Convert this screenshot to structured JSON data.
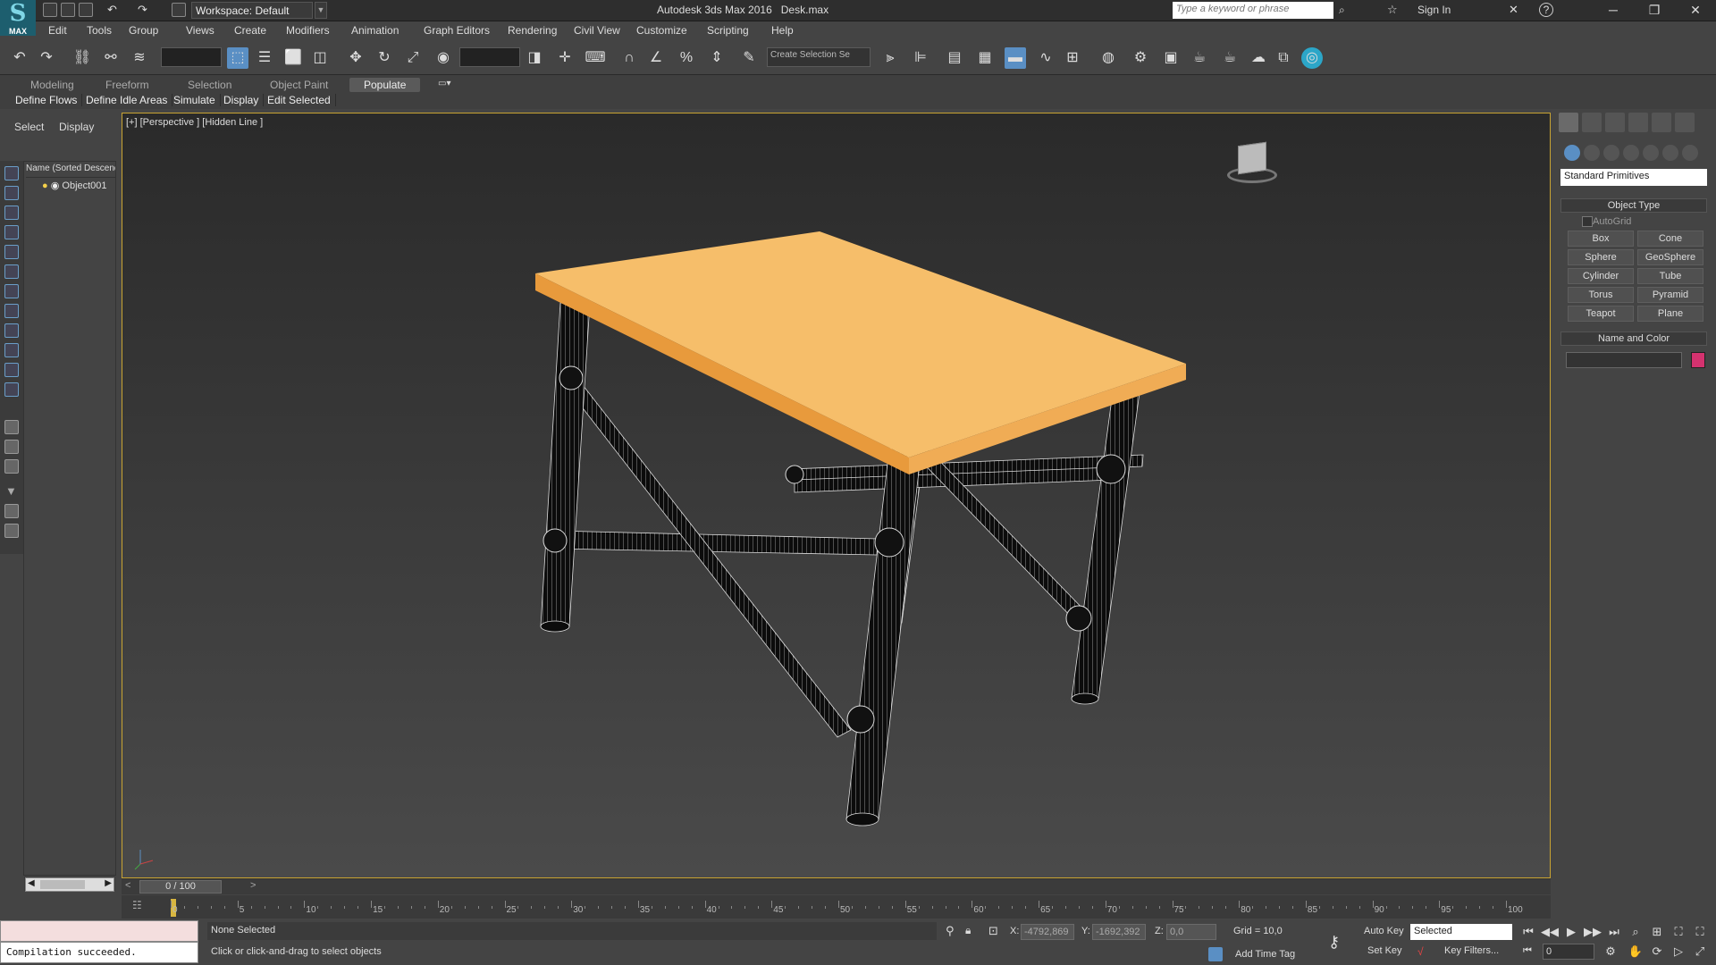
{
  "titlebar": {
    "workspace": "Workspace: Default",
    "app_title": "Autodesk 3ds Max 2016",
    "file_name": "Desk.max",
    "search_placeholder": "Type a keyword or phrase",
    "sign_in": "Sign In",
    "logo_text": "MAX"
  },
  "menubar": [
    "Edit",
    "Tools",
    "Group",
    "Views",
    "Create",
    "Modifiers",
    "Animation",
    "Graph Editors",
    "Rendering",
    "Civil View",
    "Customize",
    "Scripting",
    "Help"
  ],
  "toolbar": {
    "selection_set_placeholder": "Create Selection Se"
  },
  "ribbon": {
    "tabs": [
      "Modeling",
      "Freeform",
      "Selection",
      "Object Paint",
      "Populate"
    ],
    "active_tab": "Populate",
    "subtabs": [
      "Define Flows",
      "Define Idle Areas",
      "Simulate",
      "Display",
      "Edit Selected"
    ]
  },
  "scene_explorer": {
    "tabs": [
      "Select",
      "Display"
    ],
    "column_header": "Name (Sorted Descending)",
    "items": [
      "Object001"
    ]
  },
  "viewport": {
    "label": "[+] [Perspective ] [Hidden Line ]",
    "tabletop_color": "#f5b35a",
    "frame_border_color": "#c9a432"
  },
  "command_panel": {
    "dropdown": "Standard Primitives",
    "object_type_header": "Object Type",
    "autogrid": "AutoGrid",
    "primitives": [
      "Box",
      "Cone",
      "Sphere",
      "GeoSphere",
      "Cylinder",
      "Tube",
      "Torus",
      "Pyramid",
      "Teapot",
      "Plane"
    ],
    "name_color_header": "Name and Color",
    "object_color": "#d4326f"
  },
  "timeline": {
    "time_slider": "0 / 100",
    "ticks": [
      "0",
      "5",
      "10",
      "15",
      "20",
      "25",
      "30",
      "35",
      "40",
      "45",
      "50",
      "55",
      "60",
      "65",
      "70",
      "75",
      "80",
      "85",
      "90",
      "95",
      "100"
    ]
  },
  "status": {
    "maxscript_output": "Compilation succeeded.",
    "selection": "None Selected",
    "prompt": "Click or click-and-drag to select objects",
    "x_label": "X:",
    "x_value": "-4792,869",
    "y_label": "Y:",
    "y_value": "-1692,392",
    "z_label": "Z:",
    "z_value": "0,0",
    "grid": "Grid = 10,0",
    "add_time_tag": "Add Time Tag",
    "auto_key": "Auto Key",
    "set_key": "Set Key",
    "selected_dropdown": "Selected",
    "key_filters": "Key Filters...",
    "frame": "0"
  }
}
